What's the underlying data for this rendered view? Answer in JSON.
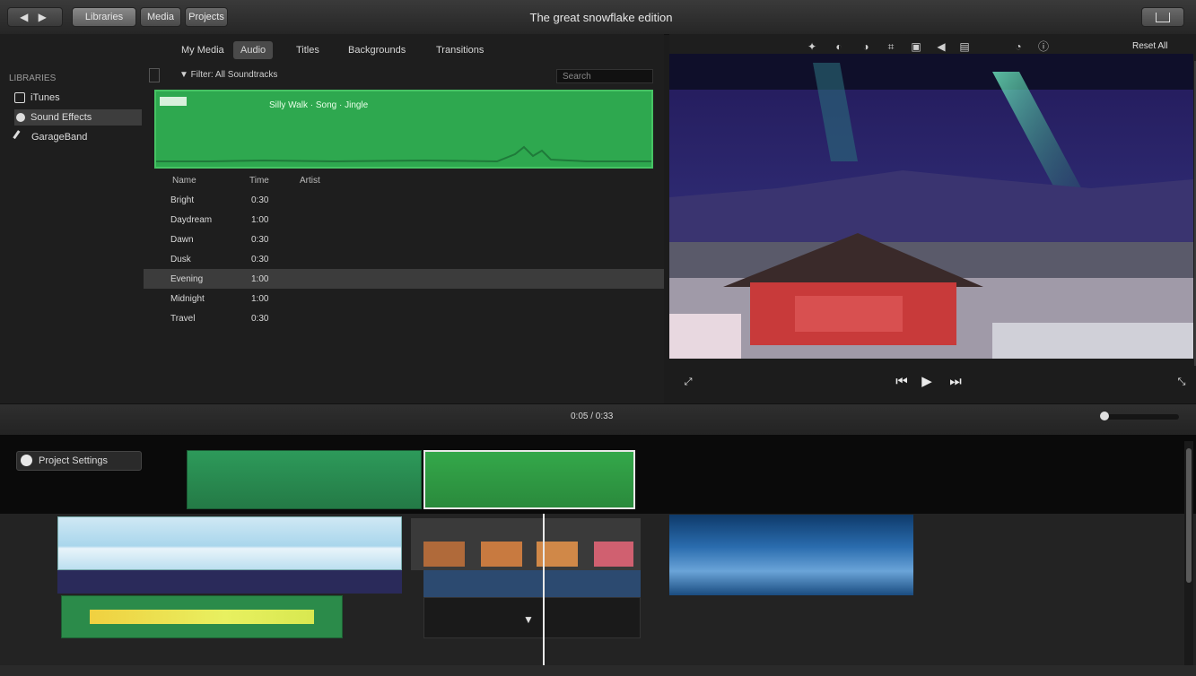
{
  "window": {
    "title": "The great snowflake edition",
    "nav_arrows": "◀ ▶",
    "buttons": [
      "Libraries",
      "Media",
      "Projects"
    ],
    "share_label": ""
  },
  "browser": {
    "tabs": [
      "My Media",
      "Audio",
      "Titles",
      "Backgrounds",
      "Transitions"
    ],
    "active_tab": 1,
    "library_header": "LIBRARIES",
    "library_items": [
      "iTunes",
      "Sound Effects",
      "GarageBand"
    ],
    "selected_library": 1,
    "filter_label": "▼ Filter: All Soundtracks",
    "search_placeholder": "Search",
    "clip_text": "Silly Walk  ·  Song  ·  Jingle",
    "table_headers": [
      "Name",
      "Time",
      "Artist"
    ],
    "table_rows": [
      {
        "name": "Bright",
        "time": "0:30"
      },
      {
        "name": "Daydream",
        "time": "1:00"
      },
      {
        "name": "Dawn",
        "time": "0:30"
      },
      {
        "name": "Dusk",
        "time": "0:30"
      },
      {
        "name": "Evening",
        "time": "1:00"
      },
      {
        "name": "Midnight",
        "time": "1:00"
      },
      {
        "name": "Travel",
        "time": "0:30"
      }
    ],
    "selected_row": 4
  },
  "viewer": {
    "toolbar_icons": [
      "magic-wand-icon",
      "color-balance-icon",
      "color-correction-icon",
      "crop-icon",
      "stabilization-icon",
      "volume-icon",
      "noise-reduction-icon",
      "speed-icon",
      "info-icon"
    ],
    "reset_all_label": "Reset All",
    "playback_icons": [
      "skip-back-icon",
      "play-icon",
      "skip-forward-icon"
    ]
  },
  "timeline": {
    "timecode": "0:05 / 0:33",
    "project_button": "Project Settings",
    "zoom_level": 0.05
  },
  "colors": {
    "audio_clip": "#2ea84f",
    "music_clip": "#2d9a5a",
    "selection_border": "#e8e8e8"
  }
}
